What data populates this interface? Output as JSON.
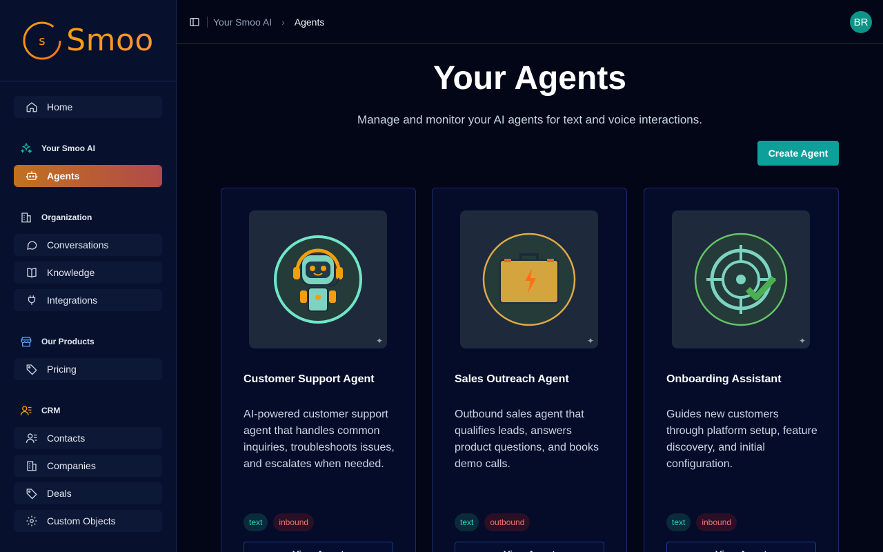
{
  "app": {
    "logo_text": "Smoo",
    "logo_letter": "s"
  },
  "sidebar": {
    "home": {
      "label": "Home",
      "icon": "home-icon"
    },
    "sections": [
      {
        "label": "Your Smoo AI",
        "icon": "sparkles-icon",
        "color": "#14b8a6",
        "items": [
          {
            "label": "Agents",
            "icon": "robot-icon",
            "active": true
          }
        ]
      },
      {
        "label": "Organization",
        "icon": "building-icon",
        "color": "#94a3b8",
        "items": [
          {
            "label": "Conversations",
            "icon": "chat-icon"
          },
          {
            "label": "Knowledge",
            "icon": "book-icon"
          },
          {
            "label": "Integrations",
            "icon": "plug-icon"
          }
        ]
      },
      {
        "label": "Our Products",
        "icon": "store-icon",
        "color": "#60a5fa",
        "items": [
          {
            "label": "Pricing",
            "icon": "tag-icon"
          }
        ]
      },
      {
        "label": "CRM",
        "icon": "users-icon",
        "color": "#f59e0b",
        "items": [
          {
            "label": "Contacts",
            "icon": "contacts-icon"
          },
          {
            "label": "Companies",
            "icon": "building-icon"
          },
          {
            "label": "Deals",
            "icon": "tag-icon"
          },
          {
            "label": "Custom Objects",
            "icon": "gear-icon"
          }
        ]
      }
    ]
  },
  "topbar": {
    "breadcrumb": [
      "Your Smoo AI",
      "Agents"
    ],
    "avatar_initials": "BR"
  },
  "page": {
    "title": "Your Agents",
    "subtitle": "Manage and monitor your AI agents for text and voice interactions.",
    "create_label": "Create Agent"
  },
  "agents": [
    {
      "name": "Customer Support Agent",
      "description": "AI-powered customer support agent that handles common inquiries, troubleshoots issues, and escalates when needed.",
      "tags": [
        "text",
        "inbound"
      ],
      "icon": "robot-headset-icon",
      "view_label": "View Agent"
    },
    {
      "name": "Sales Outreach Agent",
      "description": "Outbound sales agent that qualifies leads, answers product questions, and books demo calls.",
      "tags": [
        "text",
        "outbound"
      ],
      "icon": "briefcase-lightning-icon",
      "view_label": "View Agent"
    },
    {
      "name": "Onboarding Assistant",
      "description": "Guides new customers through platform setup, feature discovery, and initial configuration.",
      "tags": [
        "text",
        "inbound"
      ],
      "icon": "target-check-icon",
      "view_label": "View Agent"
    }
  ],
  "colors": {
    "accent_teal": "#0f9f9a",
    "brand_orange": "#f59e0b"
  }
}
